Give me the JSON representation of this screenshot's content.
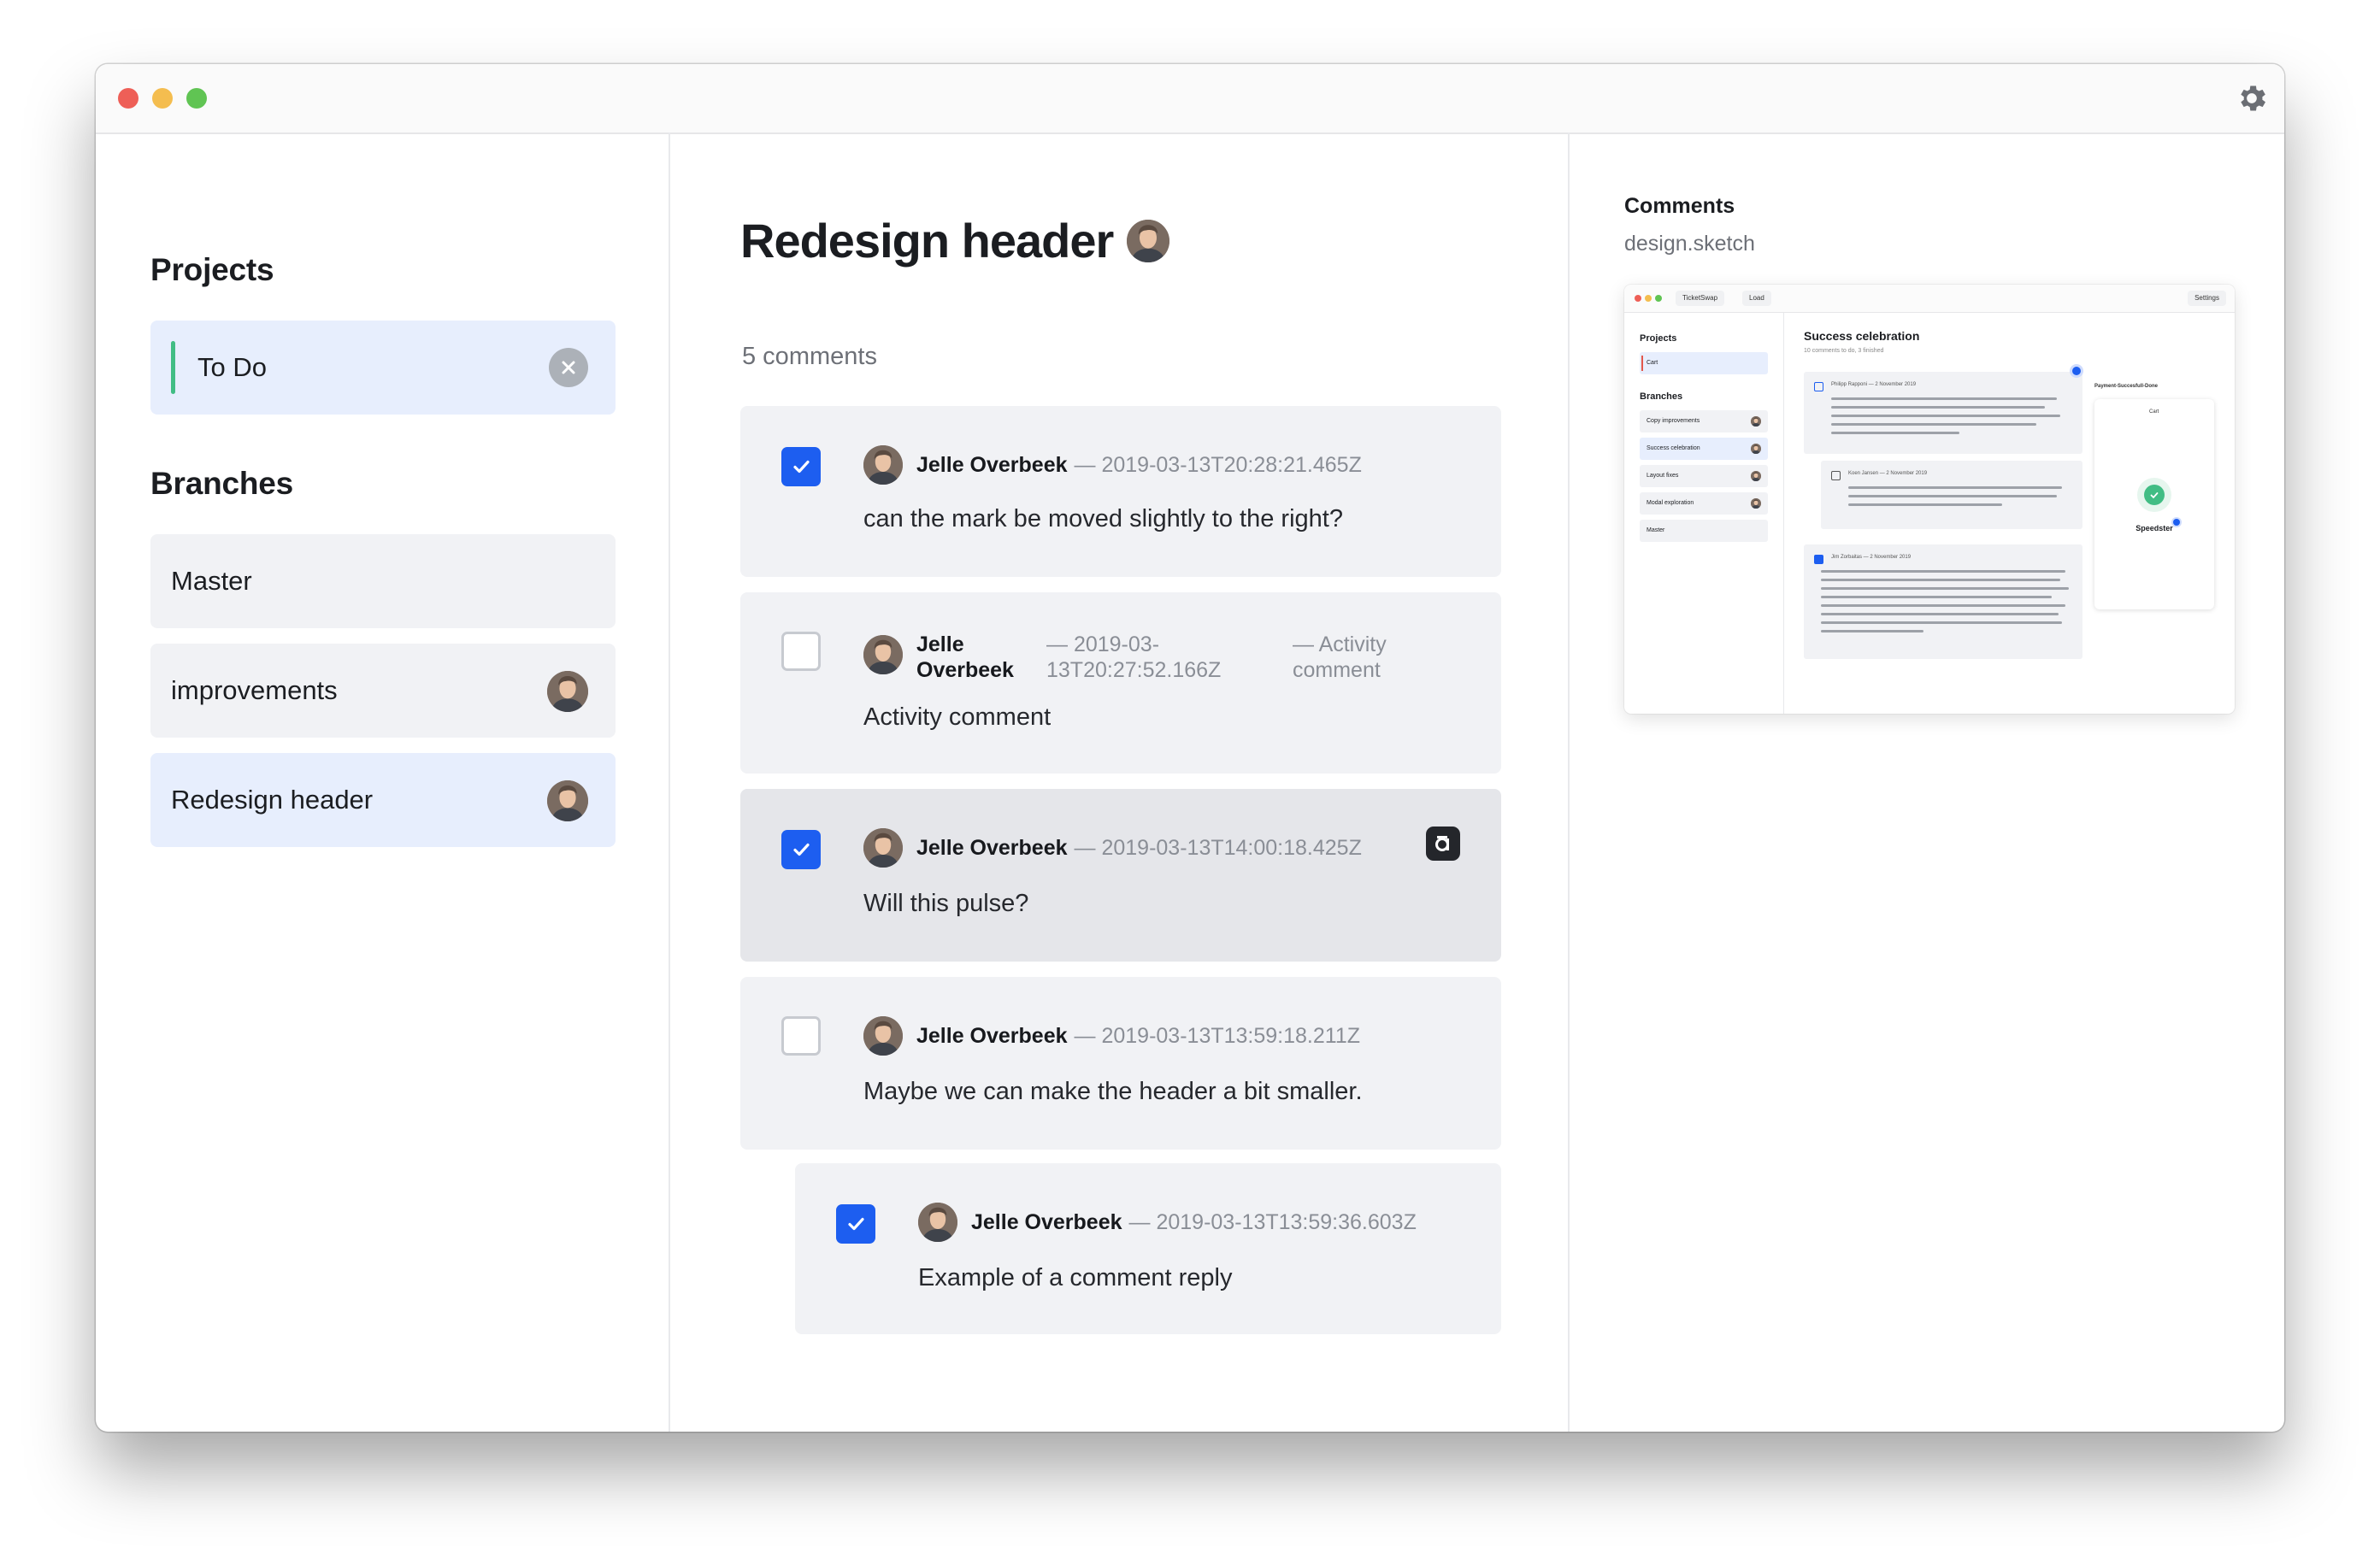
{
  "sidebar": {
    "projects_title": "Projects",
    "project": {
      "label": "To Do",
      "accent": "#41bd84"
    },
    "branches_title": "Branches",
    "branches": [
      {
        "label": "Master",
        "has_avatar": false
      },
      {
        "label": "improvements",
        "has_avatar": true
      },
      {
        "label": "Redesign header",
        "has_avatar": true,
        "active": true
      }
    ]
  },
  "main": {
    "title": "Redesign header",
    "subtitle": "5 comments",
    "comments": [
      {
        "checked": true,
        "name": "Jelle Overbeek",
        "time": "— 2019-03-13T20:28:21.465Z",
        "text": "can the mark be moved slightly to the right?"
      },
      {
        "checked": false,
        "name": "Jelle Overbeek",
        "time": "— 2019-03-13T20:27:52.166Z",
        "activity": "— Activity comment",
        "text": "Activity comment"
      },
      {
        "checked": true,
        "name": "Jelle Overbeek",
        "time": "— 2019-03-13T14:00:18.425Z",
        "text": "Will this pulse?",
        "icon": "abstract-icon"
      },
      {
        "checked": false,
        "name": "Jelle Overbeek",
        "time": "— 2019-03-13T13:59:18.211Z",
        "text": "Maybe we can make the header a bit smaller."
      },
      {
        "checked": true,
        "name": "Jelle Overbeek",
        "time": "— 2019-03-13T13:59:36.603Z",
        "text": "Example of a comment reply",
        "reply": true
      }
    ]
  },
  "right": {
    "title": "Comments",
    "file": "design.sketch",
    "preview": {
      "pill_project": "TicketSwap",
      "pill_load": "Load",
      "pill_settings": "Settings",
      "projects": "Projects",
      "project_item": "Cart",
      "branches": "Branches",
      "branch_items": [
        "Copy improvements",
        "Success celebration",
        "Layout fixes",
        "Modal exploration",
        "Master"
      ],
      "heading": "Success celebration",
      "subheading": "10 comments to do, 3 finished",
      "c1_author": "Philipp Rapponi — 2 November 2019",
      "c2_author": "Koen Jansen — 2 November 2019",
      "c3_author": "Jim Zorbaitas — 2 November 2019",
      "phone_title": "Payment-Succesfull-Done",
      "phone_sub": "Cart",
      "phone_label": "Speedster"
    }
  },
  "colors": {
    "accent": "#1d5ef0",
    "selected_bg": "#e7eefd",
    "card_bg": "#f1f2f5"
  }
}
